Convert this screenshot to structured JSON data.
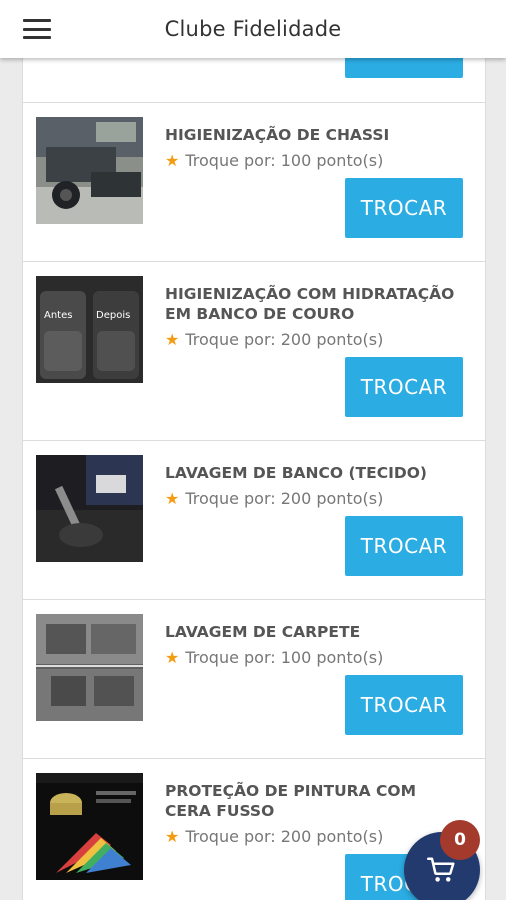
{
  "header": {
    "title": "Clube Fidelidade",
    "menu_icon": "hamburger-icon"
  },
  "button_label": "TROCAR",
  "colors": {
    "accent": "#2bace2",
    "star": "#f39c12",
    "fab": "#223a6e",
    "badge": "#a33a2c"
  },
  "items": [
    {
      "title": "HIGIENIZAÇÃO DE CHASSI",
      "points_label": "Troque por: 100 ponto(s)"
    },
    {
      "title": "HIGIENIZAÇÃO COM HIDRATAÇÃO EM BANCO DE COURO",
      "points_label": "Troque por: 200 ponto(s)",
      "image_text_left": "Antes",
      "image_text_right": "Depois"
    },
    {
      "title": "LAVAGEM DE BANCO (TECIDO)",
      "points_label": "Troque por: 200 ponto(s)"
    },
    {
      "title": "LAVAGEM DE CARPETE",
      "points_label": "Troque por: 100 ponto(s)"
    },
    {
      "title": "PROTEÇÃO DE PINTURA COM CERA FUSSO",
      "points_label": "Troque por: 200 ponto(s)"
    }
  ],
  "cart": {
    "count": "0",
    "icon": "cart-icon"
  }
}
